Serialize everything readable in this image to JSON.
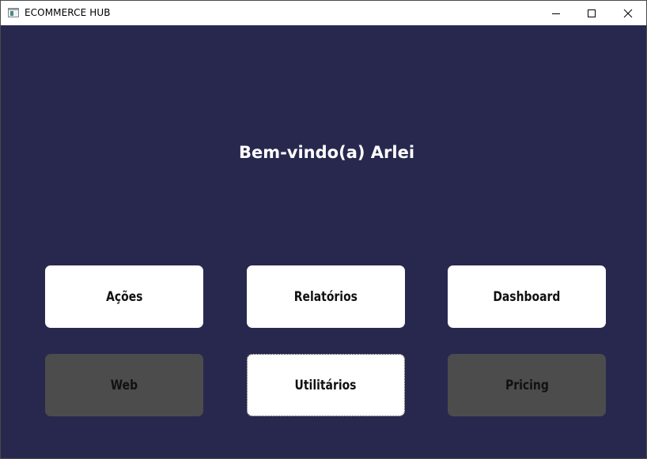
{
  "window": {
    "title": "ECOMMERCE HUB",
    "icons": {
      "app": "app-window-icon",
      "minimize": "minimize-icon",
      "maximize": "maximize-icon",
      "close": "close-icon"
    }
  },
  "colors": {
    "background": "#28284f",
    "tile_active": "#ffffff",
    "tile_disabled": "#4c4c4c"
  },
  "main": {
    "welcome": "Bem-vindo(a) Arlei",
    "tiles": [
      {
        "label": "Ações",
        "enabled": true
      },
      {
        "label": "Relatórios",
        "enabled": true
      },
      {
        "label": "Dashboard",
        "enabled": true
      },
      {
        "label": "Web",
        "enabled": false
      },
      {
        "label": "Utilitários",
        "enabled": true,
        "focused": true
      },
      {
        "label": "Pricing",
        "enabled": false
      }
    ]
  }
}
